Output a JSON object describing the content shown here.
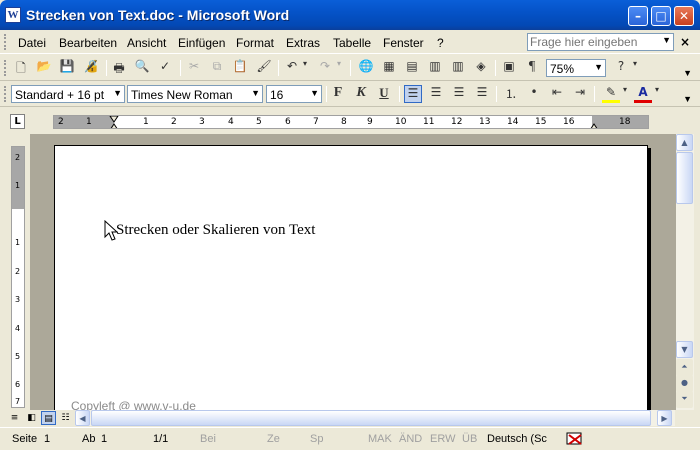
{
  "window": {
    "title": "Strecken von Text.doc - Microsoft Word",
    "app_icon": "W",
    "minimize_glyph": "–",
    "maximize_glyph": "□",
    "close_glyph": "✕"
  },
  "menubar": {
    "items": [
      "Datei",
      "Bearbeiten",
      "Ansicht",
      "Einfügen",
      "Format",
      "Extras",
      "Tabelle",
      "Fenster",
      "?"
    ],
    "help_placeholder": "Frage hier eingeben",
    "doc_close_glyph": "×"
  },
  "toolbar_standard": {
    "zoom": "75%",
    "icons": [
      "new-document-icon",
      "open-folder-icon",
      "save-icon",
      "permission-icon",
      "print-icon",
      "print-preview-icon",
      "spelling-icon",
      "cut-icon",
      "copy-icon",
      "paste-icon",
      "format-painter-icon",
      "undo-icon",
      "redo-icon",
      "hyperlink-icon",
      "tables-borders-icon",
      "insert-table-icon",
      "insert-excel-icon",
      "columns-icon",
      "drawing-icon",
      "document-map-icon",
      "show-formatting-icon",
      "help-icon"
    ],
    "pilcrow": "¶"
  },
  "toolbar_format": {
    "style": "Standard + 16 pt",
    "font": "Times New Roman",
    "size": "16",
    "bold": "F",
    "italic": "K",
    "underline": "U",
    "icons": [
      "align-left-icon",
      "center-icon",
      "align-right-icon",
      "justify-icon",
      "numbering-icon",
      "bullets-icon",
      "decrease-indent-icon",
      "increase-indent-icon",
      "highlight-icon",
      "font-color-icon"
    ]
  },
  "ruler": {
    "tab_selector": "L",
    "h_labels": [
      "2",
      "1",
      "1",
      "2",
      "3",
      "4",
      "5",
      "6",
      "7",
      "8",
      "9",
      "10",
      "11",
      "12",
      "13",
      "14",
      "15",
      "16",
      "18"
    ],
    "v_labels": [
      "2",
      "1",
      "1",
      "2",
      "3",
      "4",
      "5",
      "6",
      "7"
    ]
  },
  "document": {
    "text": "Strecken oder Skalieren von Text",
    "watermark": "Copyleft @ www.v-u.de"
  },
  "statusbar": {
    "page": "Seite",
    "page_num": "1",
    "section": "Ab",
    "section_num": "1",
    "page_of": "1/1",
    "at": "Bei",
    "line": "Ze",
    "column": "Sp",
    "mak": "MAK",
    "and": "ÄND",
    "erw": "ERW",
    "ub": "ÜB",
    "language": "Deutsch (Sc"
  }
}
